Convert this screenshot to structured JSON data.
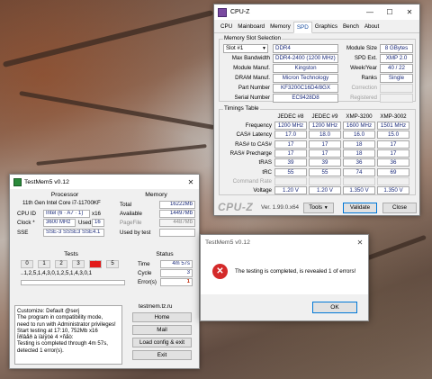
{
  "cpuz": {
    "title": "CPU-Z",
    "tabs": [
      "CPU",
      "Mainboard",
      "Memory",
      "SPD",
      "Graphics",
      "Bench",
      "About"
    ],
    "active_tab": "SPD",
    "slot_group": "Memory Slot Selection",
    "slot": "Slot #1",
    "type": "DDR4",
    "module_size_label": "Module Size",
    "module_size": "8 GBytes",
    "max_bandwidth_label": "Max Bandwidth",
    "max_bandwidth": "DDR4-2400 (1200 MHz)",
    "spd_ext_label": "SPD Ext.",
    "spd_ext": "XMP 2.0",
    "module_manuf_label": "Module Manuf.",
    "module_manuf": "Kingston",
    "week_year_label": "Week/Year",
    "week_year": "40 / 22",
    "dram_manuf_label": "DRAM Manuf.",
    "dram_manuf": "Micron Technology",
    "ranks_label": "Ranks",
    "ranks": "Single",
    "part_number_label": "Part Number",
    "part_number": "KF3200C16D4/8GX",
    "correction_label": "Correction",
    "serial_number_label": "Serial Number",
    "serial_number": "EC9428D8",
    "registered_label": "Registered",
    "timings_group": "Timings Table",
    "timing_columns": [
      "JEDEC #8",
      "JEDEC #9",
      "XMP-3200",
      "XMP-3002"
    ],
    "timing_rows": [
      {
        "label": "Frequency",
        "values": [
          "1200 MHz",
          "1200 MHz",
          "1600 MHz",
          "1501 MHz"
        ]
      },
      {
        "label": "CAS# Latency",
        "values": [
          "17.0",
          "18.0",
          "16.0",
          "15.0"
        ]
      },
      {
        "label": "RAS# to CAS#",
        "values": [
          "17",
          "17",
          "18",
          "17"
        ]
      },
      {
        "label": "RAS# Precharge",
        "values": [
          "17",
          "17",
          "18",
          "17"
        ]
      },
      {
        "label": "tRAS",
        "values": [
          "39",
          "39",
          "36",
          "36"
        ]
      },
      {
        "label": "tRC",
        "values": [
          "55",
          "55",
          "74",
          "69"
        ]
      },
      {
        "label": "Command Rate",
        "values": [
          "",
          "",
          "",
          ""
        ]
      },
      {
        "label": "Voltage",
        "values": [
          "1.20 V",
          "1.20 V",
          "1.350 V",
          "1.350 V"
        ]
      }
    ],
    "brand": "CPU-Z",
    "version": "Ver. 1.99.0.x64",
    "tools_label": "Tools",
    "validate_label": "Validate",
    "close_label": "Close"
  },
  "testmem": {
    "title": "TestMem5 v0.12",
    "processor_hdr": "Processor",
    "processor_name": "11th Gen Intel Core i7-11700KF",
    "cpu_id_label": "CPU ID",
    "cpu_id": "Intel (6 · A7 · 1)",
    "cpu_id_x": "x16",
    "clock_label": "Clock *",
    "clock": "3600 MHz",
    "used_label": "Used",
    "used": "16",
    "sse_label": "SSE",
    "sse": "SSE-3 SSSE3 SSE4.1",
    "memory_hdr": "Memory",
    "total_label": "Total",
    "total": "16222Mb",
    "available_label": "Available",
    "available": "14497Mb",
    "pagefile_label": "PageFile",
    "pagefile": "4487Mb",
    "used_by_test_label": "Used by test",
    "used_by_test": "",
    "tests_hdr": "Tests",
    "test_cells": [
      "0",
      "1",
      "2",
      "3",
      "4",
      "5"
    ],
    "failed_test_index": 4,
    "test_sequence": "..1,2,5,1,4,3,0,1,2,5,1,4,3,0,1",
    "status_hdr": "Status",
    "time_label": "Time",
    "time": "4m 57s",
    "cycle_label": "Cycle",
    "cycle": "3",
    "errors_label": "Error(s)",
    "errors": "1",
    "log_lines": [
      "Customize: Default @serj",
      "The program in compatibility mode,",
      "need to run with Administrator privileges!",
      "Start testing at 17:10, 752Mb x16",
      "Ïðîâåð à ïàìÿòè 4 ×ñåò:",
      "Testing is completed through 4m 57s,",
      "detected 1 error(s)."
    ],
    "site": "testmem.tz.ru",
    "buttons": [
      "Home",
      "Mail",
      "Load config & exit",
      "Exit"
    ]
  },
  "dialog": {
    "title": "TestMem5 v0.12",
    "message": "The testing is completed, is revealed 1 of errors!",
    "ok_label": "OK"
  }
}
